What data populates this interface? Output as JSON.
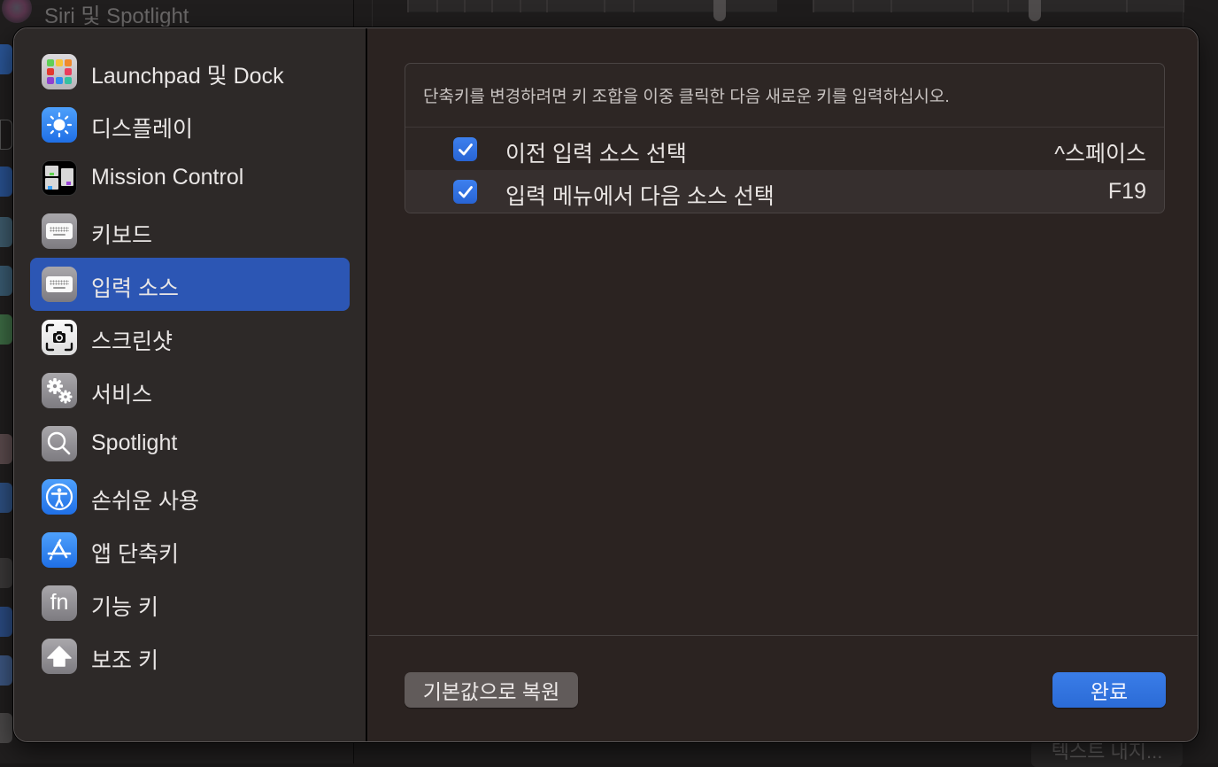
{
  "background": {
    "sidebar_top_label": "Siri 및 Spotlight",
    "bottom_button_label": "텍스트 내지..."
  },
  "sidebar": {
    "selected_index": 4,
    "items": [
      {
        "label": "Launchpad 및 Dock",
        "icon": "launchpad-icon"
      },
      {
        "label": "디스플레이",
        "icon": "display-brightness-icon"
      },
      {
        "label": "Mission Control",
        "icon": "mission-control-icon"
      },
      {
        "label": "키보드",
        "icon": "keyboard-icon"
      },
      {
        "label": "입력 소스",
        "icon": "keyboard-icon"
      },
      {
        "label": "스크린샷",
        "icon": "screenshot-camera-icon"
      },
      {
        "label": "서비스",
        "icon": "gears-icon"
      },
      {
        "label": "Spotlight",
        "icon": "magnifier-icon"
      },
      {
        "label": "손쉬운 사용",
        "icon": "accessibility-icon"
      },
      {
        "label": "앱 단축키",
        "icon": "app-store-icon"
      },
      {
        "label": "기능 키",
        "icon": "fn-key-icon"
      },
      {
        "label": "보조 키",
        "icon": "modifier-arrow-up-icon"
      }
    ],
    "fn_glyph": "fn"
  },
  "main": {
    "hint": "단축키를 변경하려면 키 조합을 이중 클릭한 다음 새로운 키를 입력하십시오.",
    "shortcuts": [
      {
        "label": "이전 입력 소스 선택",
        "key": "^스페이스",
        "checked": true
      },
      {
        "label": "입력 메뉴에서 다음 소스 선택",
        "key": "F19",
        "checked": true
      }
    ]
  },
  "footer": {
    "restore_defaults_label": "기본값으로 복원",
    "done_label": "완료"
  },
  "colors": {
    "accent": "#2c56b4",
    "checkbox": "#2f6fe0",
    "done_button": "#3274e0",
    "sheet_bg": "#2b2321"
  }
}
